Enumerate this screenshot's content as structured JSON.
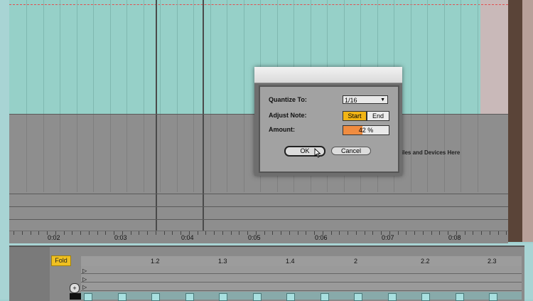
{
  "arrangement": {
    "drop_hint": "p Files and Devices Here",
    "timeline_labels": [
      "0:02",
      "0:03",
      "0:04",
      "0:05",
      "0:06",
      "0:07",
      "0:08"
    ]
  },
  "clip_editor": {
    "fold_label": "Fold",
    "ruler_labels": [
      "1.2",
      "1.3",
      "1.4",
      "2",
      "2.2",
      "2.3"
    ]
  },
  "quantize_dialog": {
    "quantize_label": "Quantize To:",
    "quantize_value": "1/16",
    "adjust_label": "Adjust Note:",
    "start_label": "Start",
    "end_label": "End",
    "amount_label": "Amount:",
    "amount_value": "42 %",
    "amount_fraction": 0.42,
    "ok_label": "OK",
    "cancel_label": "Cancel"
  },
  "colors": {
    "clip_teal": "#96d0c8",
    "accent_yellow": "#f2b515",
    "amount_orange": "#f08c40"
  }
}
